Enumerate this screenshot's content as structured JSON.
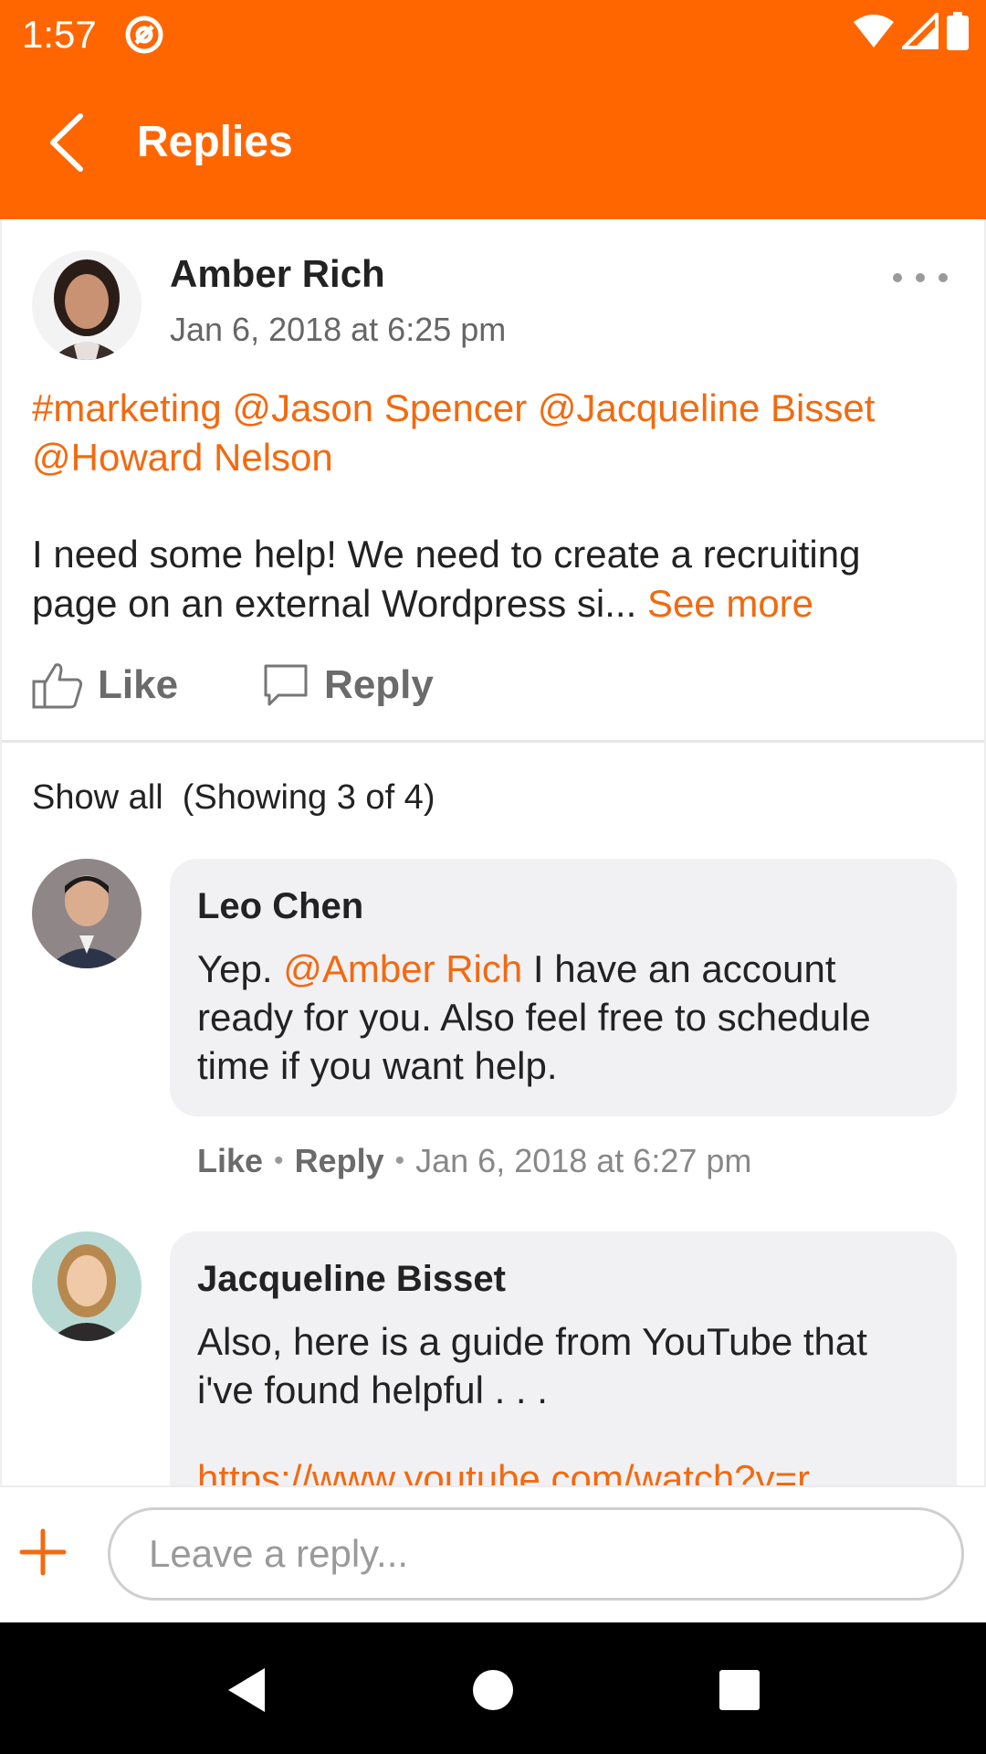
{
  "status_bar": {
    "time": "1:57",
    "icons": [
      "at-sign-icon",
      "wifi-icon",
      "signal-icon",
      "battery-icon"
    ]
  },
  "app_bar": {
    "title": "Replies",
    "back_icon": "chevron-left-icon",
    "background": "#ff6600"
  },
  "post": {
    "author": "Amber Rich",
    "date": "Jan 6, 2018 at 6:25 pm",
    "tags": "#marketing @Jason Spencer @Jacqueline Bisset @Howard Nelson",
    "body": "I need some help! We need to create a recruiting page on an external Wordpress si...",
    "see_more": "See more",
    "actions": {
      "like": "Like",
      "reply": "Reply"
    }
  },
  "replies_header": {
    "show_all": "Show all",
    "count": "(Showing 3 of 4)"
  },
  "replies": [
    {
      "author": "Leo Chen",
      "text_before": "Yep. ",
      "mention": "@Amber Rich",
      "text_after": " I have an account ready for you.  Also feel free to schedule time if you want help.",
      "like": "Like",
      "reply": "Reply",
      "date": "Jan 6, 2018 at 6:27 pm"
    },
    {
      "author": "Jacqueline Bisset",
      "text": "Also, here is a guide from YouTube that i've found helpful . . .",
      "link": "https://www.youtube.com/watch?v=r"
    }
  ],
  "composer": {
    "placeholder": "Leave a reply...",
    "add_icon": "plus-icon"
  },
  "colors": {
    "accent": "#ff6600",
    "link": "#f26a10",
    "bubble": "#f1f1f4"
  }
}
